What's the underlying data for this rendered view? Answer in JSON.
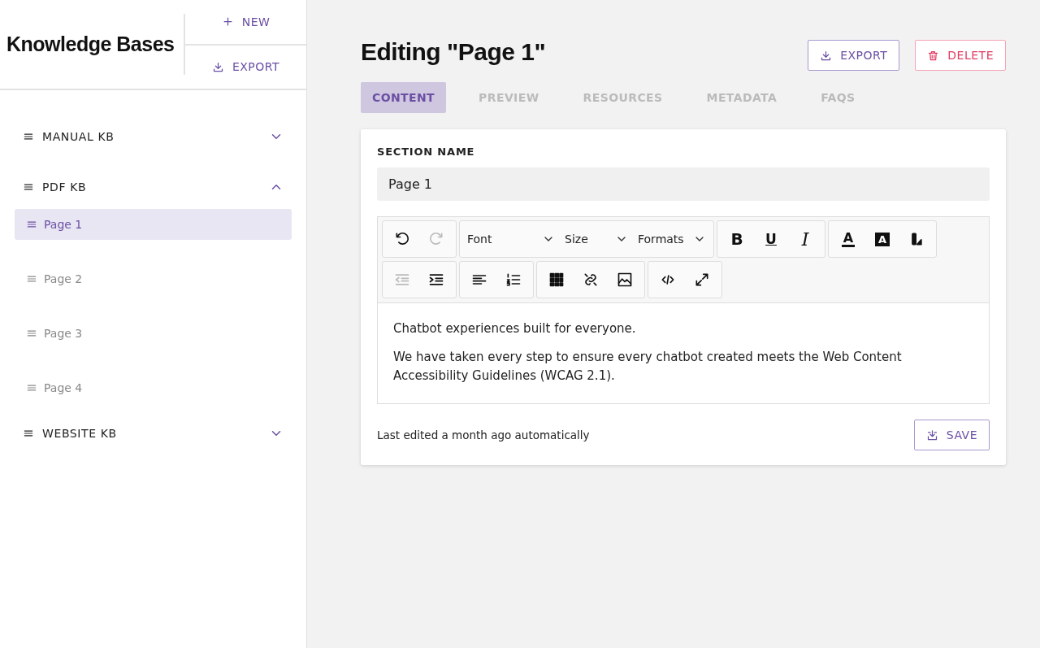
{
  "sidebar": {
    "title": "Knowledge Bases",
    "actions": [
      {
        "kind": "new",
        "label": "NEW"
      },
      {
        "kind": "export",
        "label": "EXPORT"
      }
    ],
    "items": [
      {
        "label": "MANUAL KB",
        "expanded": false
      },
      {
        "label": "PDF KB",
        "expanded": true,
        "children": [
          {
            "label": "Page 1",
            "selected": true
          },
          {
            "label": "Page 2",
            "selected": false
          },
          {
            "label": "Page 3",
            "selected": false
          },
          {
            "label": "Page 4",
            "selected": false
          }
        ]
      },
      {
        "label": "WEBSITE KB",
        "expanded": false
      }
    ]
  },
  "main": {
    "title": "Editing \"Page 1\"",
    "actions": [
      {
        "kind": "export",
        "label": "EXPORT"
      },
      {
        "kind": "delete",
        "label": "DELETE"
      }
    ],
    "tabs": [
      {
        "label": "CONTENT",
        "selected": true
      },
      {
        "label": "PREVIEW",
        "selected": false
      },
      {
        "label": "RESOURCES",
        "selected": false
      },
      {
        "label": "METADATA",
        "selected": false
      },
      {
        "label": "FAQS",
        "selected": false
      }
    ],
    "section_name": {
      "label": "SECTION NAME",
      "value": "Page 1"
    },
    "toolbar": [
      [
        [
          {
            "kind": "undo",
            "disabled": false
          },
          {
            "kind": "redo",
            "disabled": true
          }
        ],
        [
          {
            "kind": "dropdown",
            "label": "Font"
          },
          {
            "kind": "dropdown",
            "label": "Size"
          },
          {
            "kind": "dropdown",
            "label": "Formats"
          }
        ],
        [
          {
            "kind": "bold",
            "label": "B"
          },
          {
            "kind": "underline",
            "label": "U"
          },
          {
            "kind": "italic",
            "label": "I"
          }
        ],
        [
          {
            "kind": "textcolor",
            "label": "A"
          },
          {
            "kind": "highlight",
            "label": "A"
          },
          {
            "kind": "clearformat"
          }
        ]
      ],
      [
        [
          {
            "kind": "outdent",
            "disabled": true
          },
          {
            "kind": "indent",
            "disabled": false
          }
        ],
        [
          {
            "kind": "align"
          },
          {
            "kind": "numbered"
          }
        ],
        [
          {
            "kind": "table"
          },
          {
            "kind": "link"
          },
          {
            "kind": "image"
          }
        ],
        [
          {
            "kind": "code"
          },
          {
            "kind": "fullscreen"
          }
        ]
      ]
    ],
    "body": [
      "Chatbot experiences built for everyone.",
      "We have taken every step to ensure every chatbot created meets the Web Content Accessibility Guidelines (WCAG 2.1)."
    ],
    "footer": {
      "status": "Last edited a month ago automatically",
      "save": "SAVE"
    }
  }
}
